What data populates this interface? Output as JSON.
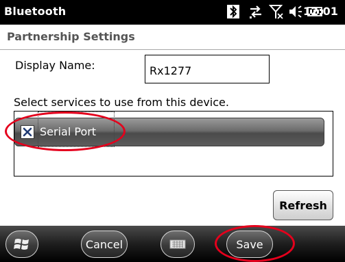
{
  "titlebar": {
    "title": "Bluetooth",
    "clock": "12:01",
    "status_icons": [
      "bluetooth-icon",
      "data-connection-icon",
      "signal-no-service-icon",
      "volume-icon",
      "battery-icon"
    ]
  },
  "section": {
    "title": "Partnership Settings"
  },
  "display_name": {
    "label": "Display Name:",
    "value": "Rx1277"
  },
  "services": {
    "label": "Select services to use from this device.",
    "items": [
      {
        "label": "Serial Port",
        "checked": true
      }
    ]
  },
  "buttons": {
    "refresh": "Refresh"
  },
  "toolbar": {
    "start_icon": "windows-start-icon",
    "cancel": "Cancel",
    "keyboard_icon": "keyboard-icon",
    "save": "Save"
  },
  "colors": {
    "annotation_red": "#e4001c",
    "titlebar_bg": "#000000"
  }
}
